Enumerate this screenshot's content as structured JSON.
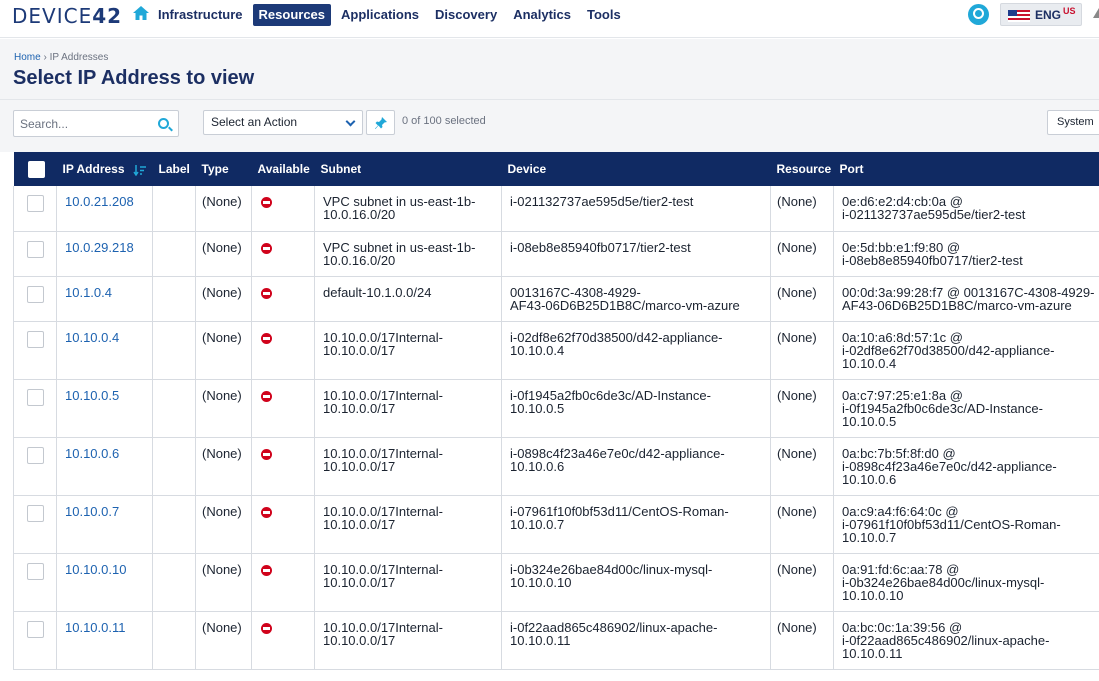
{
  "brand": {
    "logo_text": "DEVICE",
    "logo_num": "42"
  },
  "nav": {
    "items": [
      {
        "label": "Infrastructure",
        "active": false
      },
      {
        "label": "Resources",
        "active": true
      },
      {
        "label": "Applications",
        "active": false
      },
      {
        "label": "Discovery",
        "active": false
      },
      {
        "label": "Analytics",
        "active": false
      },
      {
        "label": "Tools",
        "active": false
      }
    ],
    "language": "ENG",
    "language_region": "US"
  },
  "breadcrumb": {
    "home": "Home",
    "separator": "›",
    "current": "IP Addresses"
  },
  "page_title": "Select IP Address to view",
  "toolbar": {
    "search_placeholder": "Search...",
    "action_select": "Select an Action",
    "selected_count": "0 of 100 selected",
    "system_button": "System"
  },
  "table": {
    "columns": [
      "IP Address",
      "Label",
      "Type",
      "Available",
      "Subnet",
      "Device",
      "Resource",
      "Port"
    ],
    "rows": [
      {
        "ip": "10.0.21.208",
        "label": "",
        "type": "(None)",
        "subnet": "VPC subnet in us-east-1b-\n10.0.16.0/20",
        "device": "i-021132737ae595d5e/tier2-test",
        "resource": "(None)",
        "port": "0e:d6:e2:d4:cb:0a @\ni-021132737ae595d5e/tier2-test"
      },
      {
        "ip": "10.0.29.218",
        "label": "",
        "type": "(None)",
        "subnet": "VPC subnet in us-east-1b-\n10.0.16.0/20",
        "device": "i-08eb8e85940fb0717/tier2-test",
        "resource": "(None)",
        "port": "0e:5d:bb:e1:f9:80 @\ni-08eb8e85940fb0717/tier2-test"
      },
      {
        "ip": "10.1.0.4",
        "label": "",
        "type": "(None)",
        "subnet": "default-10.1.0.0/24",
        "device": "0013167C-4308-4929-\nAF43-06D6B25D1B8C/marco-vm-azure",
        "resource": "(None)",
        "port": "00:0d:3a:99:28:f7 @ 0013167C-4308-4929-\nAF43-06D6B25D1B8C/marco-vm-azure"
      },
      {
        "ip": "10.10.0.4",
        "label": "",
        "type": "(None)",
        "subnet": "10.10.0.0/17Internal-\n10.10.0.0/17",
        "device": "i-02df8e62f70d38500/d42-appliance-\n10.10.0.4",
        "resource": "(None)",
        "port": "0a:10:a6:8d:57:1c @\ni-02df8e62f70d38500/d42-appliance-\n10.10.0.4"
      },
      {
        "ip": "10.10.0.5",
        "label": "",
        "type": "(None)",
        "subnet": "10.10.0.0/17Internal-\n10.10.0.0/17",
        "device": "i-0f1945a2fb0c6de3c/AD-Instance-\n10.10.0.5",
        "resource": "(None)",
        "port": "0a:c7:97:25:e1:8a @\ni-0f1945a2fb0c6de3c/AD-Instance-\n10.10.0.5"
      },
      {
        "ip": "10.10.0.6",
        "label": "",
        "type": "(None)",
        "subnet": "10.10.0.0/17Internal-\n10.10.0.0/17",
        "device": "i-0898c4f23a46e7e0c/d42-appliance-\n10.10.0.6",
        "resource": "(None)",
        "port": "0a:bc:7b:5f:8f:d0 @\ni-0898c4f23a46e7e0c/d42-appliance-\n10.10.0.6"
      },
      {
        "ip": "10.10.0.7",
        "label": "",
        "type": "(None)",
        "subnet": "10.10.0.0/17Internal-\n10.10.0.0/17",
        "device": "i-07961f10f0bf53d11/CentOS-Roman-\n10.10.0.7",
        "resource": "(None)",
        "port": "0a:c9:a4:f6:64:0c @\ni-07961f10f0bf53d11/CentOS-Roman-\n10.10.0.7"
      },
      {
        "ip": "10.10.0.10",
        "label": "",
        "type": "(None)",
        "subnet": "10.10.0.0/17Internal-\n10.10.0.0/17",
        "device": "i-0b324e26bae84d00c/linux-mysql-\n10.10.0.10",
        "resource": "(None)",
        "port": "0a:91:fd:6c:aa:78 @\ni-0b324e26bae84d00c/linux-mysql-\n10.10.0.10"
      },
      {
        "ip": "10.10.0.11",
        "label": "",
        "type": "(None)",
        "subnet": "10.10.0.0/17Internal-\n10.10.0.0/17",
        "device": "i-0f22aad865c486902/linux-apache-\n10.10.0.11",
        "resource": "(None)",
        "port": "0a:bc:0c:1a:39:56 @\ni-0f22aad865c486902/linux-apache-\n10.10.0.11"
      }
    ]
  },
  "colors": {
    "navy": "#102a63",
    "link": "#1d62b0",
    "accent": "#20a8d8",
    "unavailable": "#d0021b"
  }
}
